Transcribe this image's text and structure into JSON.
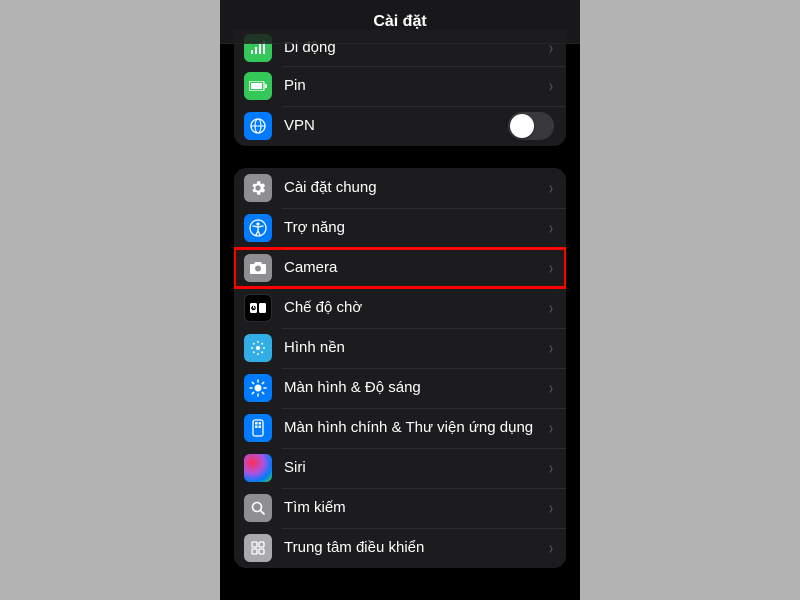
{
  "header": {
    "title": "Cài đặt"
  },
  "group1": {
    "items": [
      {
        "label": "Di động",
        "icon": "cellular-icon"
      },
      {
        "label": "Pin",
        "icon": "battery-icon"
      },
      {
        "label": "VPN",
        "icon": "vpn-icon",
        "toggle": false
      }
    ]
  },
  "group2": {
    "items": [
      {
        "label": "Cài đặt chung",
        "icon": "gear-icon"
      },
      {
        "label": "Trợ năng",
        "icon": "accessibility-icon"
      },
      {
        "label": "Camera",
        "icon": "camera-icon",
        "highlighted": true
      },
      {
        "label": "Chế độ chờ",
        "icon": "standby-icon"
      },
      {
        "label": "Hình nền",
        "icon": "wallpaper-icon"
      },
      {
        "label": "Màn hình & Độ sáng",
        "icon": "display-icon"
      },
      {
        "label": "Màn hình chính & Thư viện ứng dụng",
        "icon": "home-screen-icon"
      },
      {
        "label": "Siri",
        "icon": "siri-icon"
      },
      {
        "label": "Tìm kiếm",
        "icon": "search-icon"
      },
      {
        "label": "Trung tâm điều khiển",
        "icon": "control-center-icon"
      }
    ]
  },
  "colors": {
    "highlight": "#ff0000",
    "background": "#000000",
    "cell": "#1c1c1e"
  }
}
